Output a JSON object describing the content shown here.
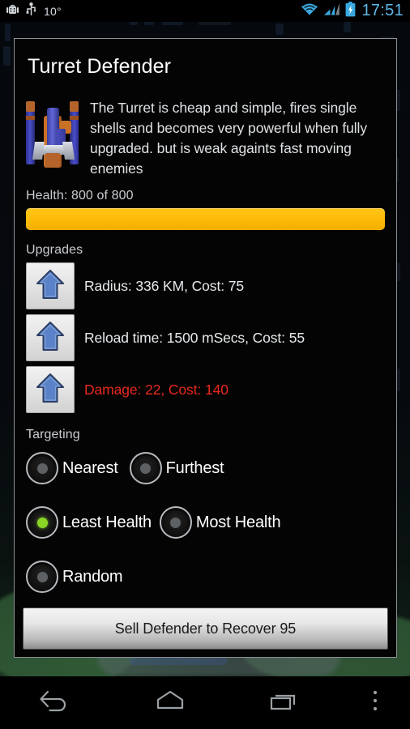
{
  "status_bar": {
    "temperature": "10°",
    "clock": "17:51",
    "icons": [
      "android-debug-icon",
      "usb-icon",
      "wifi-icon",
      "cellular-signal-icon",
      "battery-charging-icon"
    ]
  },
  "dialog": {
    "title": "Turret Defender",
    "sprite_icon": "turret-sprite-icon",
    "description": "The Turret is cheap and simple, fires single shells and becomes very powerful when fully upgraded. but is weak againts fast moving enemies",
    "health": {
      "label": "Health: 800 of 800",
      "current": 800,
      "max": 800,
      "percent": 100,
      "bar_color": "#ffbd0a"
    },
    "upgrades": {
      "section_label": "Upgrades",
      "items": [
        {
          "label": "Radius: 336 KM, Cost: 75",
          "state": "normal",
          "icon": "up-arrow-icon"
        },
        {
          "label": "Reload time: 1500 mSecs, Cost: 55",
          "state": "normal",
          "icon": "up-arrow-icon"
        },
        {
          "label": "Damage: 22, Cost: 140",
          "state": "locked",
          "icon": "up-arrow-icon"
        }
      ],
      "locked_color": "#e8291c",
      "normal_color": "#e6e9ec"
    },
    "targeting": {
      "section_label": "Targeting",
      "selected": "Least Health",
      "selected_color": "#8ad625",
      "rows": [
        [
          {
            "label": "Nearest",
            "selected": false
          },
          {
            "label": "Furthest",
            "selected": false
          }
        ],
        [
          {
            "label": "Least Health",
            "selected": true
          },
          {
            "label": "Most Health",
            "selected": false
          }
        ],
        [
          {
            "label": "Random",
            "selected": false
          }
        ]
      ]
    },
    "sell_button_label": "Sell Defender to Recover 95"
  },
  "nav_bar": {
    "back": "back-icon",
    "home": "home-icon",
    "recents": "recents-icon",
    "menu": "overflow-menu-icon"
  }
}
